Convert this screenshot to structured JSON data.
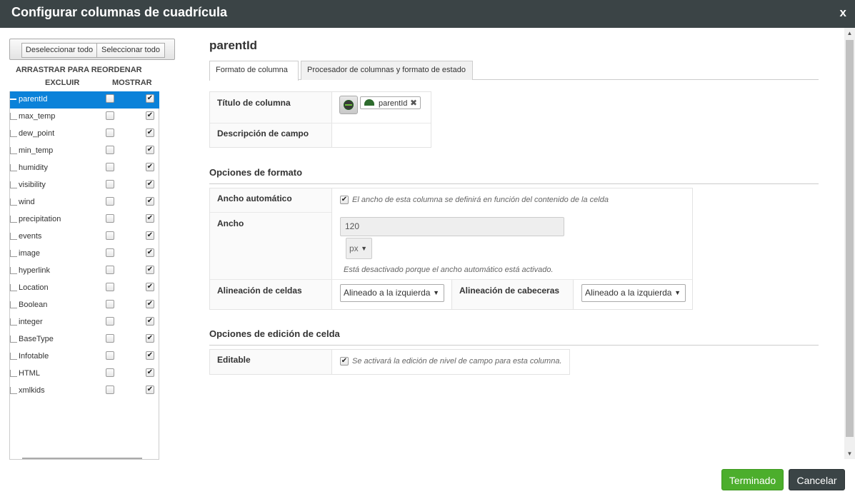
{
  "dialog": {
    "title": "Configurar columnas de cuadrícula",
    "close_label": "x"
  },
  "left": {
    "deselect_all": "Deseleccionar todo",
    "select_all": "Seleccionar todo",
    "drag_hint": "ARRASTRAR PARA REORDENAR",
    "col_exclude": "EXCLUIR",
    "col_show": "MOSTRAR",
    "columns": [
      {
        "name": "parentId",
        "excluded": false,
        "shown": true,
        "selected": true
      },
      {
        "name": "max_temp",
        "excluded": false,
        "shown": true
      },
      {
        "name": "dew_point",
        "excluded": false,
        "shown": true
      },
      {
        "name": "min_temp",
        "excluded": false,
        "shown": true
      },
      {
        "name": "humidity",
        "excluded": false,
        "shown": true
      },
      {
        "name": "visibility",
        "excluded": false,
        "shown": true
      },
      {
        "name": "wind",
        "excluded": false,
        "shown": true
      },
      {
        "name": "precipitation",
        "excluded": false,
        "shown": true
      },
      {
        "name": "events",
        "excluded": false,
        "shown": true
      },
      {
        "name": "image",
        "excluded": false,
        "shown": true
      },
      {
        "name": "hyperlink",
        "excluded": false,
        "shown": true
      },
      {
        "name": "Location",
        "excluded": false,
        "shown": true
      },
      {
        "name": "Boolean",
        "excluded": false,
        "shown": true
      },
      {
        "name": "integer",
        "excluded": false,
        "shown": true
      },
      {
        "name": "BaseType",
        "excluded": false,
        "shown": true
      },
      {
        "name": "Infotable",
        "excluded": false,
        "shown": true
      },
      {
        "name": "HTML",
        "excluded": false,
        "shown": true
      },
      {
        "name": "xmlkids",
        "excluded": false,
        "shown": true
      }
    ]
  },
  "right": {
    "field_title": "parentId",
    "tabs": [
      {
        "label": "Formato de columna",
        "active": true
      },
      {
        "label": "Procesador de columnas y formato de estado",
        "active": false
      }
    ],
    "column_title_label": "Título de columna",
    "column_title_tag": "parentId",
    "field_description_label": "Descripción de campo",
    "format_section": "Opciones de formato",
    "auto_width_label": "Ancho automático",
    "auto_width_note": "El ancho de esta columna se definirá en función del contenido de la celda",
    "width_label": "Ancho",
    "width_value": "120",
    "width_unit": "px",
    "width_disabled_note": "Está desactivado porque el ancho automático está activado.",
    "cell_align_label": "Alineación de celdas",
    "cell_align_value": "Alineado a la izquierda",
    "header_align_label": "Alineación de cabeceras",
    "header_align_value": "Alineado a la izquierda",
    "edit_section": "Opciones de edición de celda",
    "editable_label": "Editable",
    "editable_note": "Se activará la edición de nivel de campo para esta columna."
  },
  "footer": {
    "done": "Terminado",
    "cancel": "Cancelar"
  },
  "colors": {
    "titlebar": "#3b4446",
    "selected_row": "#0b82d9",
    "done_button": "#4cae2c",
    "cancel_button": "#3b4446"
  }
}
